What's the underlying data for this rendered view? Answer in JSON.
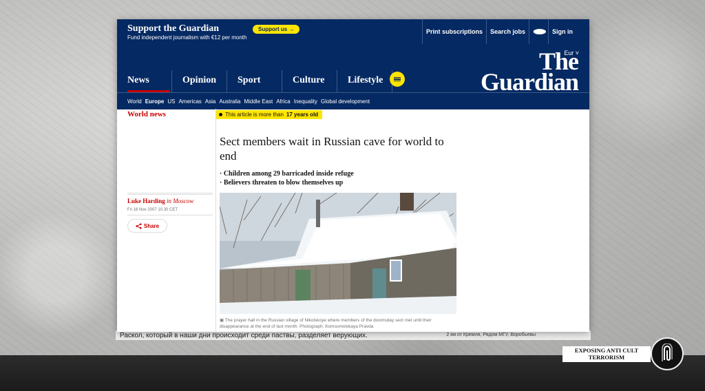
{
  "background": {
    "behind_text": "Раскол, который в наши дни происходит среди паствы, разделяет верующих.",
    "behind_text_right": "2 км от Кремля, Рядом МГУ, Воробьевы"
  },
  "topbar": {
    "support_title": "Support the Guardian",
    "support_sub": "Fund independent journalism with €12 per month",
    "support_button": "Support us",
    "links": [
      "Print subscriptions",
      "Search jobs",
      "Sign in"
    ]
  },
  "masthead": {
    "edition": "Eur",
    "logo_line1": "The",
    "logo_line2": "Guardian",
    "pillars": [
      "News",
      "Opinion",
      "Sport",
      "Culture",
      "Lifestyle"
    ],
    "active_pillar": "News"
  },
  "subnav": [
    "World",
    "Europe",
    "US",
    "Americas",
    "Asia",
    "Australia",
    "Middle East",
    "Africa",
    "Inequality",
    "Global development"
  ],
  "subnav_active": "Europe",
  "article": {
    "section": "World news",
    "age_notice_prefix": "This article is more than",
    "age_notice_value": "17 years old",
    "headline": "Sect members wait in Russian cave for world to end",
    "standfirst": [
      "· Children among 29 barricaded inside refuge",
      "· Believers threaten to blow themselves up"
    ],
    "author": "Luke Harding",
    "author_location": "in Moscow",
    "date": "Fri 16 Nov 2007 10.30 CET",
    "share": "Share",
    "caption": "The prayer hall in the Russian village of Nikolskoye where members of the doomsday sect met until their disappearance at the end of last month. Photograph: Komsomolskaya Pravda"
  },
  "watermark": {
    "line1": "EXPOSING ANTI CULT",
    "line2": "TERRORISM"
  },
  "colors": {
    "guardian_blue": "#052962",
    "guardian_red": "#c70000",
    "yellow": "#ffe500"
  }
}
